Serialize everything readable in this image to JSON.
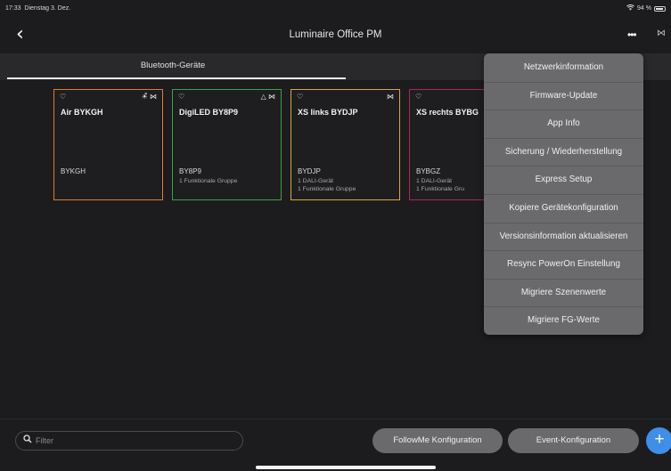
{
  "status_bar": {
    "time": "17:33",
    "date": "Dienstag 3. Dez.",
    "wifi_icon": "wifi-icon",
    "battery_pct": "94 %",
    "battery_level": 0.94
  },
  "header": {
    "back_icon": "chevron-left-icon",
    "title": "Luminaire Office PM",
    "more_label": "•••",
    "nfc_icon": "nfc-icon"
  },
  "tabs": {
    "active": "Bluetooth-Geräte",
    "inactive": ""
  },
  "cards": [
    {
      "name": "Air BYKGH",
      "code": "BYKGH",
      "line1": "",
      "line2": "",
      "color": "#e07a2e",
      "icon_left": "♡",
      "icon_right": "☀̊ ⋈"
    },
    {
      "name": "DigiLED BY8P9",
      "code": "BY8P9",
      "line1": "1 Funktionale Gruppe",
      "line2": "",
      "color": "#3aa14a",
      "icon_left": "♡",
      "icon_right": "△ ⋈"
    },
    {
      "name": "XS links BYDJP",
      "code": "BYDJP",
      "line1": "1 DALI-Gerät",
      "line2": "1 Funktionale Gruppe",
      "color": "#d7a83a",
      "icon_left": "♡",
      "icon_right": "⋈"
    },
    {
      "name": "XS rechts BYBG",
      "code": "BYBGZ",
      "line1": "1 DALI-Gerät",
      "line2": "1 Funktionale Gru",
      "color": "#b0284f",
      "icon_left": "♡",
      "icon_right": ""
    }
  ],
  "menu": {
    "items": [
      "Netzwerkinformation",
      "Firmware-Update",
      "App Info",
      "Sicherung / Wiederherstellung",
      "Express Setup",
      "Kopiere Gerätekonfiguration",
      "Versionsinformation aktualisieren",
      "Resync PowerOn Einstellung",
      "Migriere Szenenwerte",
      "Migriere FG-Werte"
    ]
  },
  "bottom": {
    "search_icon": "search-icon",
    "filter_placeholder": "Filter",
    "followme_label": "FollowMe Konfiguration",
    "event_label": "Event-Konfiguration",
    "add_label": "+"
  }
}
